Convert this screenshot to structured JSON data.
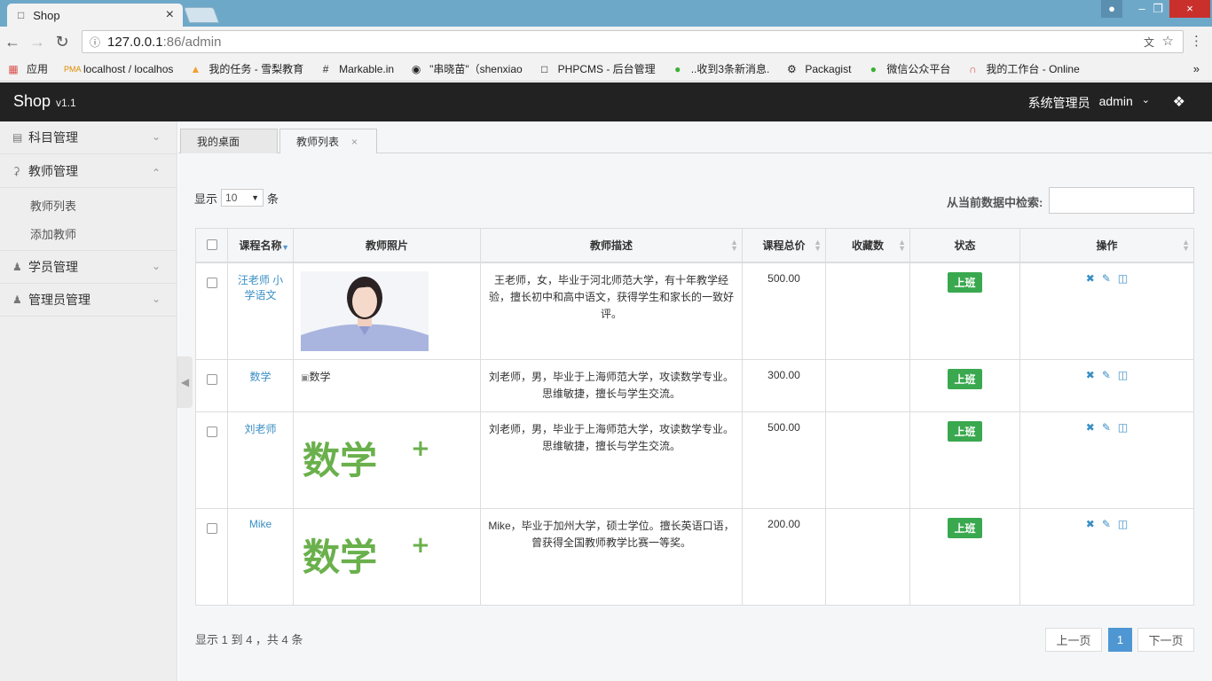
{
  "browser": {
    "tab_title": "Shop",
    "url_host": "127.0.0.1",
    "url_rest": ":86/admin",
    "bookmarks": [
      {
        "label": "应用",
        "icon": "apps-grid-icon"
      },
      {
        "label": "localhost / localhos",
        "icon": "pma-icon"
      },
      {
        "label": "我的任务 - 雪梨教育",
        "icon": "flame-icon"
      },
      {
        "label": "Markable.in",
        "icon": "hash-icon"
      },
      {
        "label": "\"串晓苗\"（shenxiao",
        "icon": "github-icon"
      },
      {
        "label": "PHPCMS - 后台管理",
        "icon": "page-icon"
      },
      {
        "label": "..收到3条新消息.",
        "icon": "wechat-icon"
      },
      {
        "label": "Packagist",
        "icon": "packagist-icon"
      },
      {
        "label": "微信公众平台",
        "icon": "wechat-icon"
      },
      {
        "label": "我的工作台 - Online",
        "icon": "arch-icon"
      }
    ]
  },
  "header": {
    "brand": "Shop",
    "version": "v1.1",
    "role": "系统管理员",
    "username": "admin"
  },
  "sidebar": {
    "menus": [
      {
        "label": "科目管理",
        "expanded": false
      },
      {
        "label": "教师管理",
        "expanded": true,
        "children": [
          "教师列表",
          "添加教师"
        ]
      },
      {
        "label": "学员管理",
        "expanded": false
      },
      {
        "label": "管理员管理",
        "expanded": false
      }
    ]
  },
  "page_tabs": [
    {
      "label": "我的桌面"
    },
    {
      "label": "教师列表",
      "close": "×"
    }
  ],
  "table_controls": {
    "show_prefix": "显示",
    "page_size": "10",
    "show_suffix": "条",
    "search_label": "从当前数据中检索:"
  },
  "columns": [
    "课程名称",
    "教师照片",
    "教师描述",
    "课程总价",
    "收藏数",
    "状态",
    "操作"
  ],
  "rows": [
    {
      "name": "汪老师 小学语文",
      "photo": "portrait",
      "photo_alt": "",
      "desc": "王老师，女，毕业于河北师范大学，有十年教学经验，擅长初中和高中语文，获得学生和家长的一致好评。",
      "price": "500.00",
      "favorites": "",
      "status": "上班"
    },
    {
      "name": "数学",
      "photo": "broken",
      "photo_alt": "数学",
      "desc": "刘老师，男，毕业于上海师范大学，攻读数学专业。思维敏捷，擅长与学生交流。",
      "price": "300.00",
      "favorites": "",
      "status": "上班"
    },
    {
      "name": "刘老师",
      "photo": "math",
      "photo_alt": "",
      "photo_text": "数学",
      "desc": "刘老师，男，毕业于上海师范大学，攻读数学专业。思维敏捷，擅长与学生交流。",
      "price": "500.00",
      "favorites": "",
      "status": "上班"
    },
    {
      "name": "Mike",
      "photo": "math",
      "photo_alt": "",
      "photo_text": "数学",
      "desc": "Mike，毕业于加州大学，硕士学位。擅长英语口语，曾获得全国教师教学比赛一等奖。",
      "price": "200.00",
      "favorites": "",
      "status": "上班"
    }
  ],
  "pagination": {
    "info": "显示 1 到 4 ，共 4 条",
    "prev": "上一页",
    "current": "1",
    "next": "下一页"
  },
  "colors": {
    "header_bg": "#222222",
    "status_green": "#3aa84f",
    "link_blue": "#3a8fc5",
    "pager_active": "#4e97d3"
  }
}
